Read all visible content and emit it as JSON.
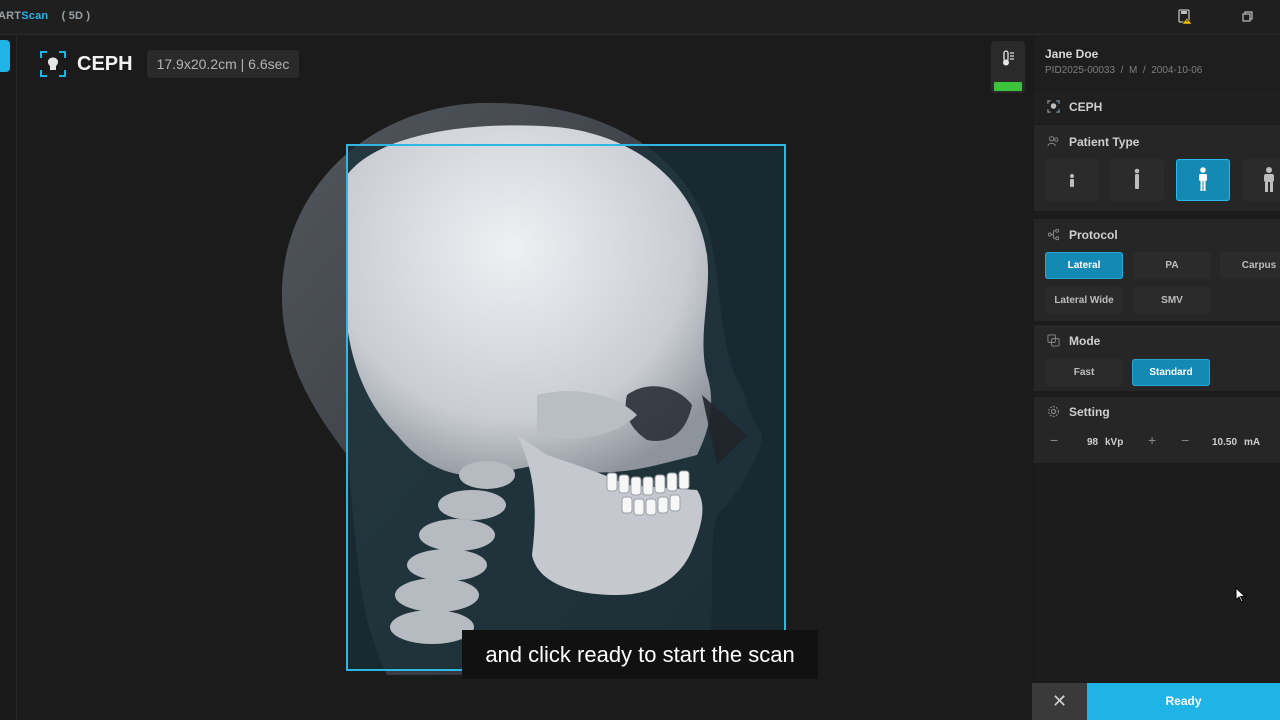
{
  "app": {
    "brand_prefix": "ART",
    "brand_suffix": "Scan",
    "mode_badge": "( 5D )",
    "icons": [
      "save-warning-icon",
      "restore-window-icon"
    ]
  },
  "viewer": {
    "title": "CEPH",
    "info": "17.9x20.2cm | 6.6sec",
    "caption": "and click ready to start the scan",
    "temperature_status_color": "#3bc43b"
  },
  "patient": {
    "name": "Jane Doe",
    "pid": "PID2025-00033",
    "sex": "M",
    "dob": "2004-10-06",
    "sep": "/"
  },
  "panel": {
    "mode_title": "CEPH",
    "patient_type": {
      "title": "Patient Type",
      "options": [
        "child-small",
        "child",
        "adult",
        "adult-large"
      ],
      "selected_index": 2
    },
    "protocol": {
      "title": "Protocol",
      "options": [
        "Lateral",
        "PA",
        "Carpus",
        "Lateral Wide",
        "SMV"
      ],
      "selected": "Lateral"
    },
    "mode": {
      "title": "Mode",
      "options": [
        "Fast",
        "Standard"
      ],
      "selected": "Standard"
    },
    "setting": {
      "title": "Setting",
      "kvp_value": "98",
      "kvp_unit": "kVp",
      "ma_value": "10.50",
      "ma_unit": "mA",
      "minus": "−",
      "plus": "+"
    }
  },
  "footer": {
    "close_label": "✕",
    "ready_label": "Ready"
  },
  "colors": {
    "accent": "#1fb3e6",
    "selected": "#1489b4",
    "status_ok": "#3bc43b"
  }
}
